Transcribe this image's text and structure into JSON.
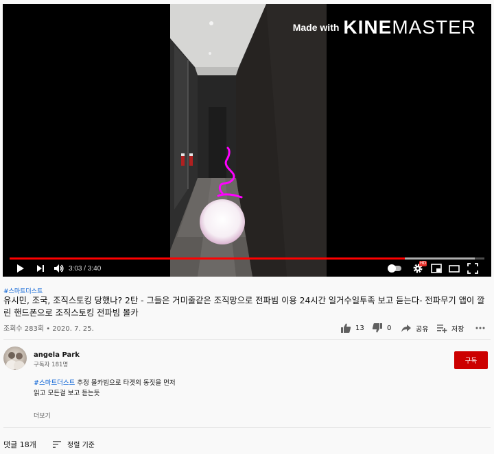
{
  "player": {
    "watermark_made": "Made with",
    "watermark_kine": "KINE",
    "watermark_master": "MASTER",
    "time_display": "3:03 / 3:40",
    "progress_fraction": 0.832,
    "buffer_fraction": 0.98,
    "hd_badge": "HD",
    "controls": {
      "play": "play-icon",
      "next": "next-icon",
      "volume": "volume-icon",
      "autoplay": "autoplay-toggle",
      "settings": "gear-icon",
      "miniplayer": "miniplayer-icon",
      "theater": "theater-icon",
      "fullscreen": "fullscreen-icon"
    }
  },
  "video": {
    "hashtag": "#스마트더스트",
    "title": "유시민, 조국, 조직스토킹 당했나? 2탄 - 그들은 거미줄같은 조직망으로 전파빔 이용 24시간 일거수일투족 보고 듣는다- 전파무기 앱이 깔린 핸드폰으로 조직스토킹 전파빔 몰카",
    "meta": "조회수 283회 • 2020. 7. 25.",
    "likes": "13",
    "dislikes": "0",
    "share_label": "공유",
    "save_label": "저장",
    "more_icon": "more-icon"
  },
  "channel": {
    "name": "angela Park",
    "subscribers": "구독자 181명",
    "subscribe_label": "구독"
  },
  "description": {
    "hashtag": "#스마트더스트",
    "line1_rest": " 추정 몰카빔으로 타겟의 동짓을 먼저",
    "line2": "읽고 모든걸 보고 듣는듯",
    "more_label": "더보기"
  },
  "comments": {
    "count_label": "댓글 18개",
    "sort_label": "정렬 기준"
  },
  "colors": {
    "accent_red": "#ff0000",
    "subscribe_red": "#cc0000",
    "link_blue": "#065fd4",
    "annotation_magenta": "#ff00ff"
  }
}
